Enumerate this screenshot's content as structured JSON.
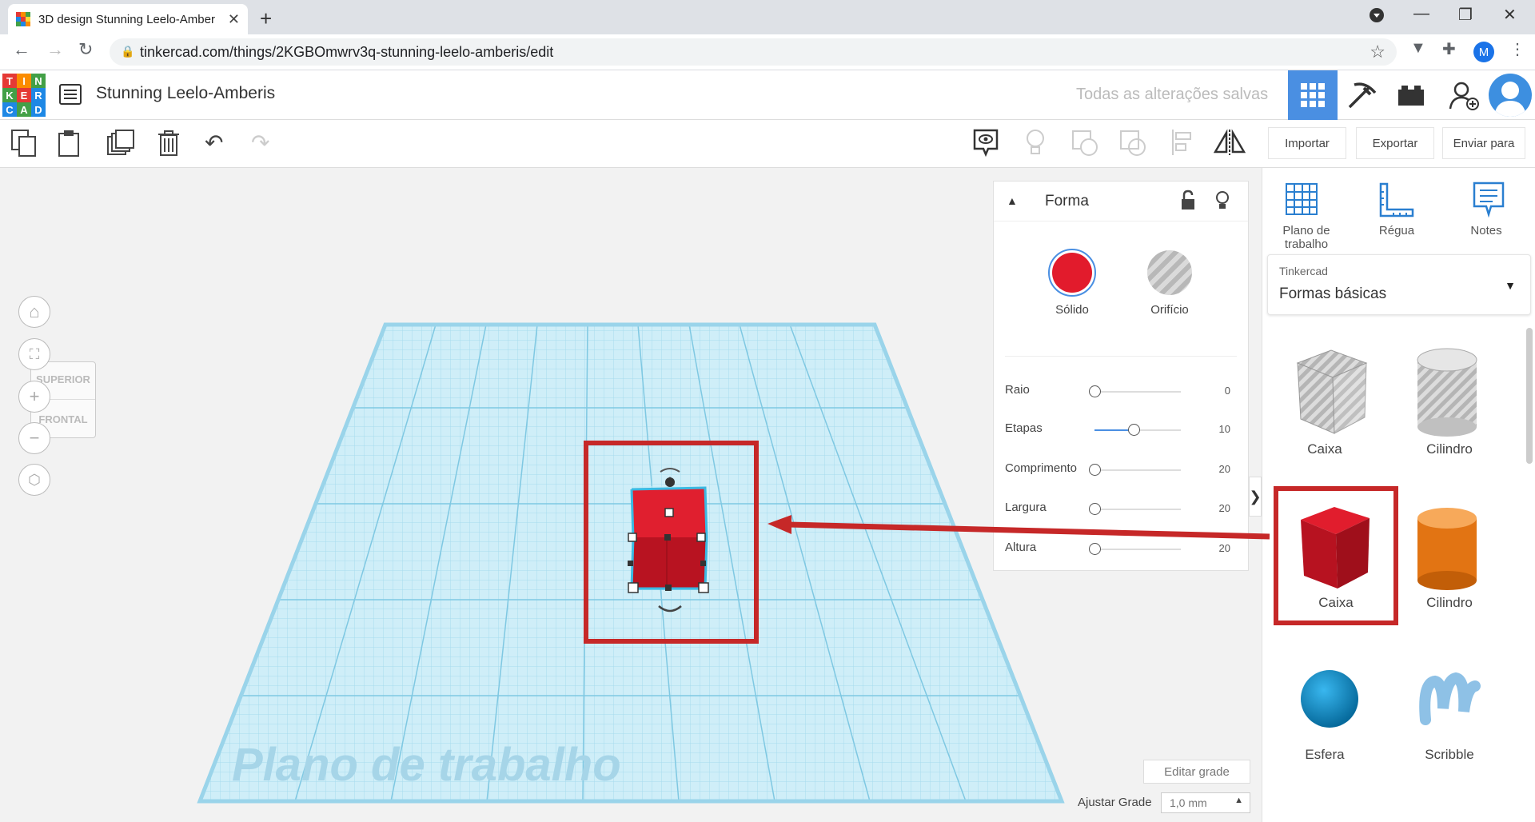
{
  "browser": {
    "tab_title": "3D design Stunning Leelo-Amber",
    "url": "tinkercad.com/things/2KGBOmwrv3q-stunning-leelo-amberis/edit",
    "profile_initial": "M"
  },
  "app": {
    "logo_letters": [
      "T",
      "I",
      "N",
      "K",
      "E",
      "R",
      "C",
      "A",
      "D"
    ],
    "design_title": "Stunning Leelo-Amberis",
    "save_status": "Todas as alterações salvas"
  },
  "toolbar": {
    "import_label": "Importar",
    "export_label": "Exportar",
    "send_label": "Enviar para"
  },
  "viewcube": {
    "top": "SUPERIOR",
    "front": "FRONTAL"
  },
  "workplane_watermark": "Plano de trabalho",
  "shape_panel": {
    "title": "Forma",
    "solid_label": "Sólido",
    "hole_label": "Orifício",
    "params": [
      {
        "label": "Raio",
        "value": "0",
        "level": 0
      },
      {
        "label": "Etapas",
        "value": "10",
        "level": 0.45
      },
      {
        "label": "Comprimento",
        "value": "20",
        "level": 0
      },
      {
        "label": "Largura",
        "value": "20",
        "level": 0
      },
      {
        "label": "Altura",
        "value": "20",
        "level": 0
      }
    ]
  },
  "right_panel": {
    "tools": [
      {
        "label": "Plano de trabalho",
        "icon": "workplane-icon"
      },
      {
        "label": "Régua",
        "icon": "ruler-icon"
      },
      {
        "label": "Notes",
        "icon": "notes-icon"
      }
    ],
    "library_source": "Tinkercad",
    "library_name": "Formas básicas",
    "shapes": [
      {
        "label": "Caixa"
      },
      {
        "label": "Cilindro"
      },
      {
        "label": "Caixa"
      },
      {
        "label": "Cilindro"
      },
      {
        "label": "Esfera"
      },
      {
        "label": "Scribble"
      }
    ]
  },
  "grid_controls": {
    "edit_grid_label": "Editar grade",
    "snap_label": "Ajustar Grade",
    "snap_value": "1,0 mm"
  },
  "colors": {
    "brand_blue": "#4a8fe2",
    "solid_red": "#e21b2c",
    "annotation_red": "#c62828"
  }
}
